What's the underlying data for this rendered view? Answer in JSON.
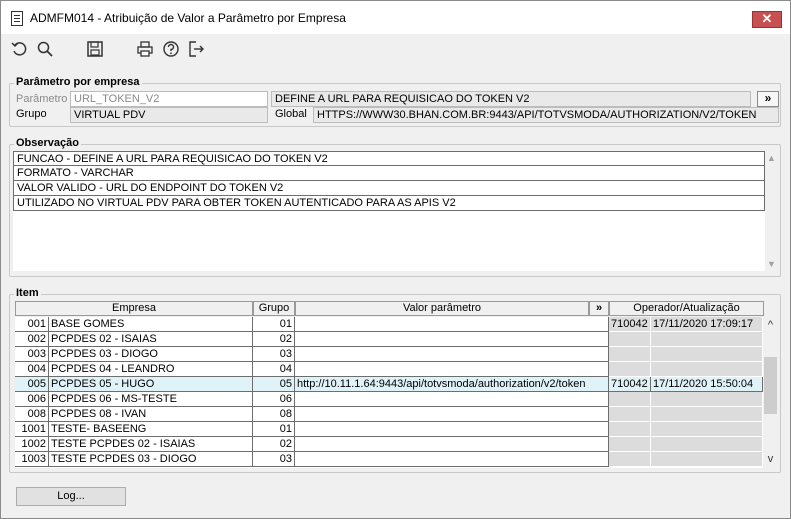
{
  "window": {
    "title": "ADMFM014 - Atribuição de Valor a Parâmetro por Empresa",
    "close": "✕"
  },
  "toolbar": {
    "undo_icon": "↺",
    "search_icon": "🔍",
    "save_icon": "💾",
    "print_icon": "🖶",
    "help_icon": "?",
    "exit_icon": "⇥"
  },
  "param": {
    "section_label": "Parâmetro por empresa",
    "param_label": "Parâmetro",
    "param_value": "URL_TOKEN_V2",
    "param_desc": "DEFINE A URL PARA REQUISICAO DO TOKEN V2",
    "expand_btn": "»",
    "group_label": "Grupo",
    "group_value": "VIRTUAL PDV",
    "global_label": "Global",
    "global_value": "HTTPS://WWW30.BHAN.COM.BR:9443/API/TOTVSMODA/AUTHORIZATION/V2/TOKEN"
  },
  "obs": {
    "section_label": "Observação",
    "lines": [
      "FUNCAO - DEFINE A URL PARA REQUISICAO DO TOKEN V2",
      "FORMATO - VARCHAR",
      "VALOR VALIDO - URL DO ENDPOINT DO TOKEN V2",
      "UTILIZADO NO VIRTUAL PDV PARA OBTER TOKEN AUTENTICADO PARA AS APIS V2"
    ],
    "scroll_up": "▲",
    "scroll_down": "▼"
  },
  "items": {
    "section_label": "Item",
    "headers": {
      "empresa": "Empresa",
      "grupo": "Grupo",
      "valor": "Valor parâmetro",
      "expand": "»",
      "operador": "Operador/Atualização"
    },
    "scroll_up": "^",
    "scroll_down": "v",
    "rows": [
      {
        "code": "001",
        "name": "BASE GOMES",
        "grupo": "01",
        "valor": "",
        "operador": "710042",
        "data": "17/11/2020 17:09:17",
        "selected": false
      },
      {
        "code": "002",
        "name": "PCPDES 02 - ISAIAS",
        "grupo": "02",
        "valor": "",
        "operador": "",
        "data": "",
        "selected": false
      },
      {
        "code": "003",
        "name": "PCPDES 03 - DIOGO",
        "grupo": "03",
        "valor": "",
        "operador": "",
        "data": "",
        "selected": false
      },
      {
        "code": "004",
        "name": "PCPDES 04 - LEANDRO",
        "grupo": "04",
        "valor": "",
        "operador": "",
        "data": "",
        "selected": false
      },
      {
        "code": "005",
        "name": "PCPDES 05 - HUGO",
        "grupo": "05",
        "valor": "http://10.11.1.64:9443/api/totvsmoda/authorization/v2/token",
        "operador": "710042",
        "data": "17/11/2020 15:50:04",
        "selected": true
      },
      {
        "code": "006",
        "name": "PCPDES 06 - MS-TESTE",
        "grupo": "06",
        "valor": "",
        "operador": "",
        "data": "",
        "selected": false
      },
      {
        "code": "008",
        "name": "PCPDES 08 - IVAN",
        "grupo": "08",
        "valor": "",
        "operador": "",
        "data": "",
        "selected": false
      },
      {
        "code": "1001",
        "name": "TESTE- BASEENG",
        "grupo": "01",
        "valor": "",
        "operador": "",
        "data": "",
        "selected": false
      },
      {
        "code": "1002",
        "name": "TESTE PCPDES 02 - ISAIAS",
        "grupo": "02",
        "valor": "",
        "operador": "",
        "data": "",
        "selected": false
      },
      {
        "code": "1003",
        "name": "TESTE PCPDES 03 - DIOGO",
        "grupo": "03",
        "valor": "",
        "operador": "",
        "data": "",
        "selected": false
      }
    ]
  },
  "log_button": "Log..."
}
